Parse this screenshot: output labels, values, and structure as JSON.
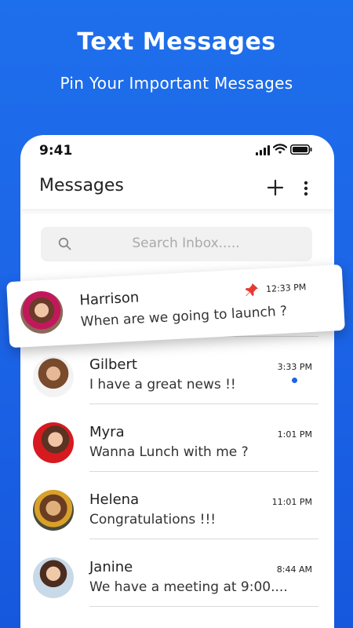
{
  "hero": {
    "title": "Text Messages",
    "subtitle": "Pin Your Important Messages"
  },
  "status_bar": {
    "time": "9:41",
    "icons": [
      "signal-icon",
      "wifi-icon",
      "battery-icon"
    ]
  },
  "app_bar": {
    "title": "Messages",
    "actions": [
      "add-icon",
      "more-icon"
    ]
  },
  "search": {
    "placeholder": "Search Inbox....."
  },
  "pinned": {
    "name": "Harrison",
    "message": "When are we going to launch ?",
    "time": "12:33 PM",
    "icon": "pin-icon"
  },
  "conversations": [
    {
      "name": "Gilbert",
      "message": "I have a great news !!",
      "time": "3:33 PM",
      "unread": true
    },
    {
      "name": "Myra",
      "message": "Wanna Lunch with me ?",
      "time": "1:01 PM",
      "unread": false
    },
    {
      "name": "Helena",
      "message": "Congratulations !!!",
      "time": "11:01 PM",
      "unread": false
    },
    {
      "name": "Janine",
      "message": "We have a meeting at 9:00....",
      "time": "8:44 AM",
      "unread": false
    }
  ],
  "colors": {
    "background": "#1e6fec",
    "accent": "#1e63e6",
    "pin": "#e53935"
  }
}
